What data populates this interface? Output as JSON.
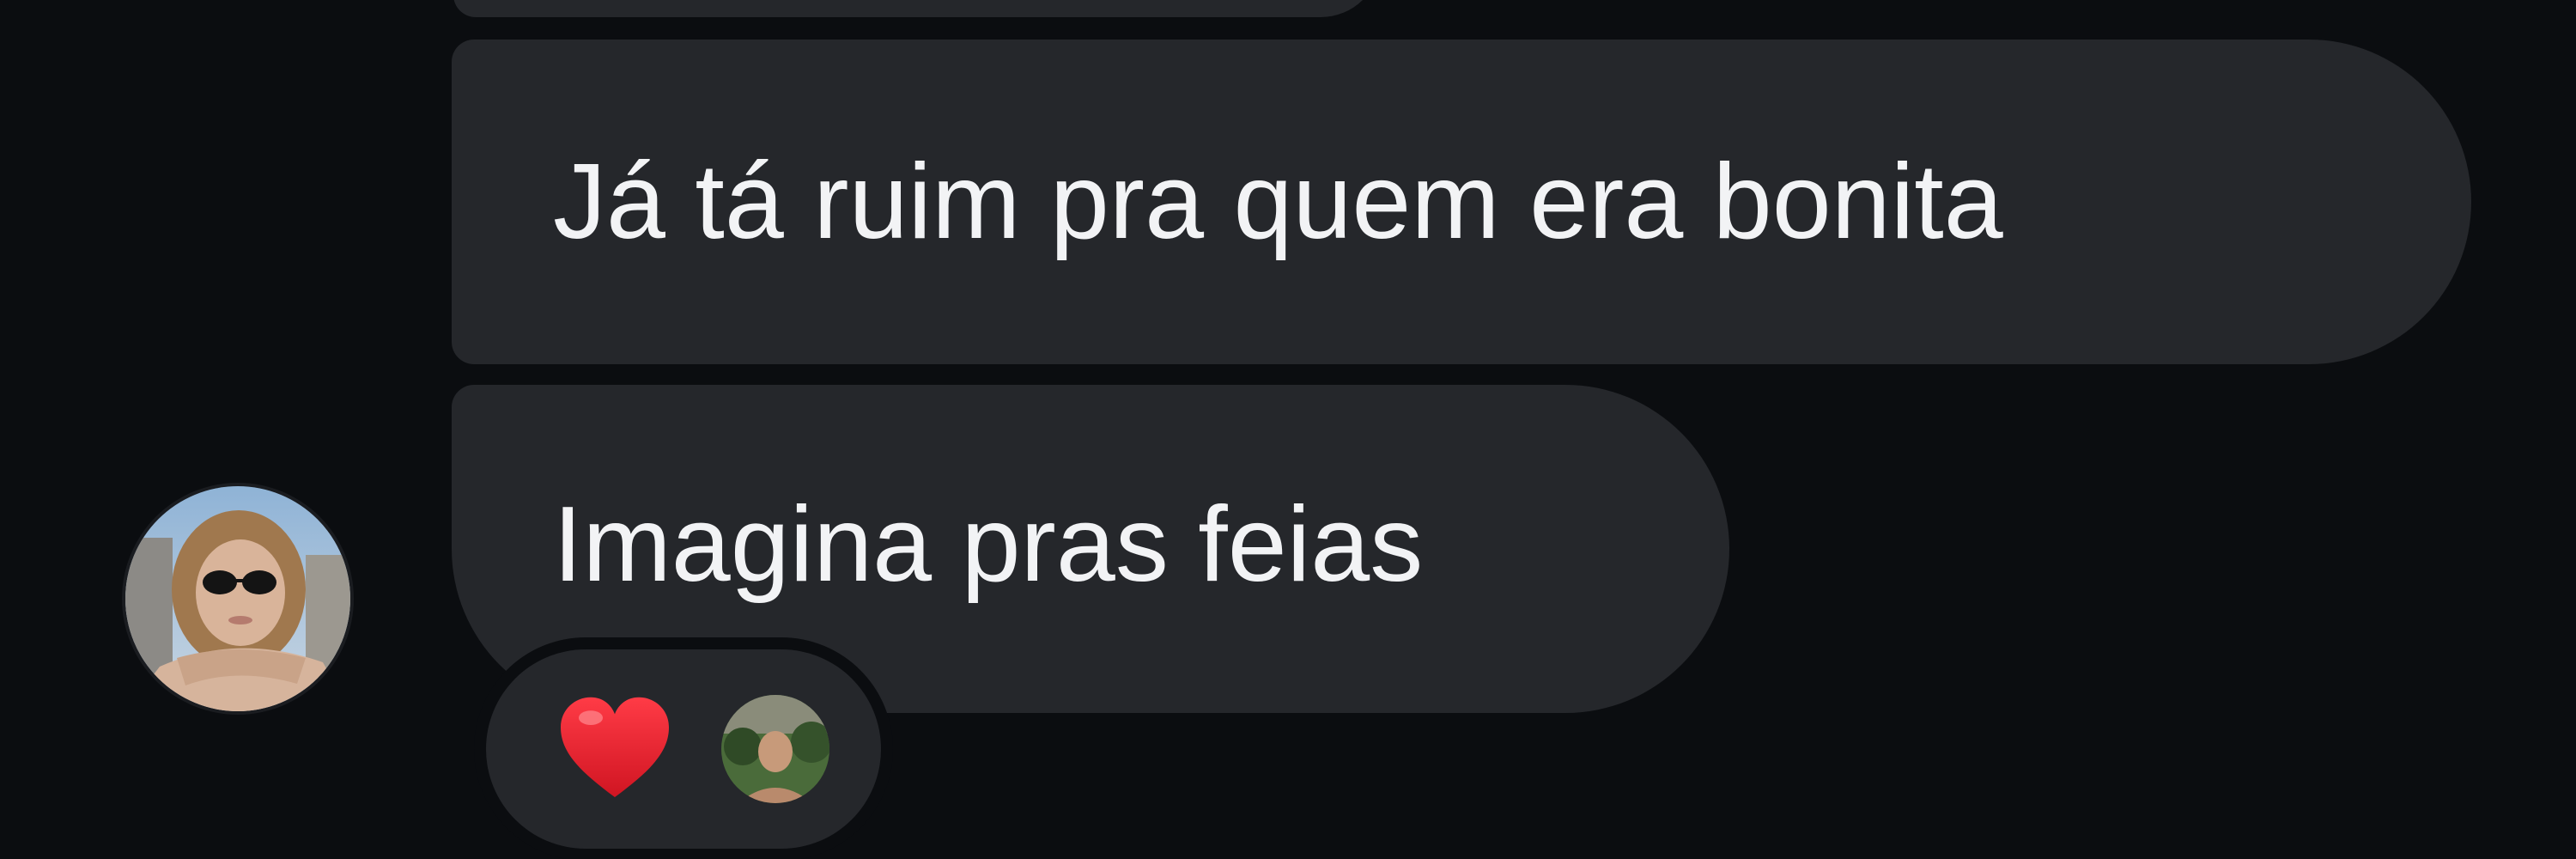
{
  "messages": [
    {
      "text": "Já tá ruim pra quem era bonita"
    },
    {
      "text": "Imagina pras feias"
    }
  ],
  "reactions": {
    "emoji": "heart-icon",
    "emoji_color": "#e8232f"
  },
  "colors": {
    "background": "#0b0d10",
    "bubble": "#25272b",
    "text": "#f2f3f5"
  }
}
